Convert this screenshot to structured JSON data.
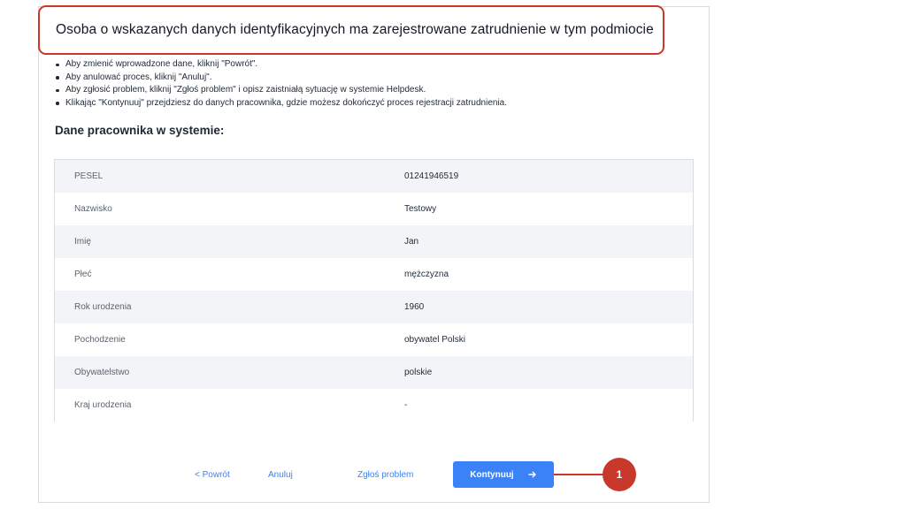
{
  "header": {
    "title": "Osoba o wskazanych danych identyfikacyjnych ma zarejestrowane zatrudnienie w tym podmiocie"
  },
  "instructions": [
    "Aby zmienić wprowadzone dane, kliknij \"Powrót\".",
    "Aby anulować proces, kliknij \"Anuluj\".",
    "Aby zgłosić problem, kliknij \"Zgłoś problem\" i opisz zaistniałą sytuację w systemie Helpdesk.",
    "Klikając \"Kontynuuj\" przejdziesz do danych pracownika, gdzie możesz dokończyć proces rejestracji zatrudnienia."
  ],
  "section": {
    "title": "Dane pracownika w systemie:"
  },
  "employee_table": {
    "rows": [
      {
        "label": "PESEL",
        "value": "01241946519"
      },
      {
        "label": "Nazwisko",
        "value": "Testowy"
      },
      {
        "label": "Imię",
        "value": "Jan"
      },
      {
        "label": "Płeć",
        "value": "mężczyzna"
      },
      {
        "label": "Rok urodzenia",
        "value": "1960"
      },
      {
        "label": "Pochodzenie",
        "value": "obywatel Polski"
      },
      {
        "label": "Obywatelstwo",
        "value": "polskie"
      },
      {
        "label": "Kraj urodzenia",
        "value": "-"
      }
    ]
  },
  "actions": {
    "back_label": "< Powrót",
    "cancel_label": "Anuluj",
    "report_label": "Zgłoś problem",
    "continue_label": "Kontynuuj",
    "continue_icon": "arrow-right-icon"
  },
  "callout": {
    "number": "1"
  },
  "colors": {
    "accent_blue": "#3b82f6",
    "highlight_red": "#c8392b",
    "row_stripe": "#f2f4f7"
  }
}
